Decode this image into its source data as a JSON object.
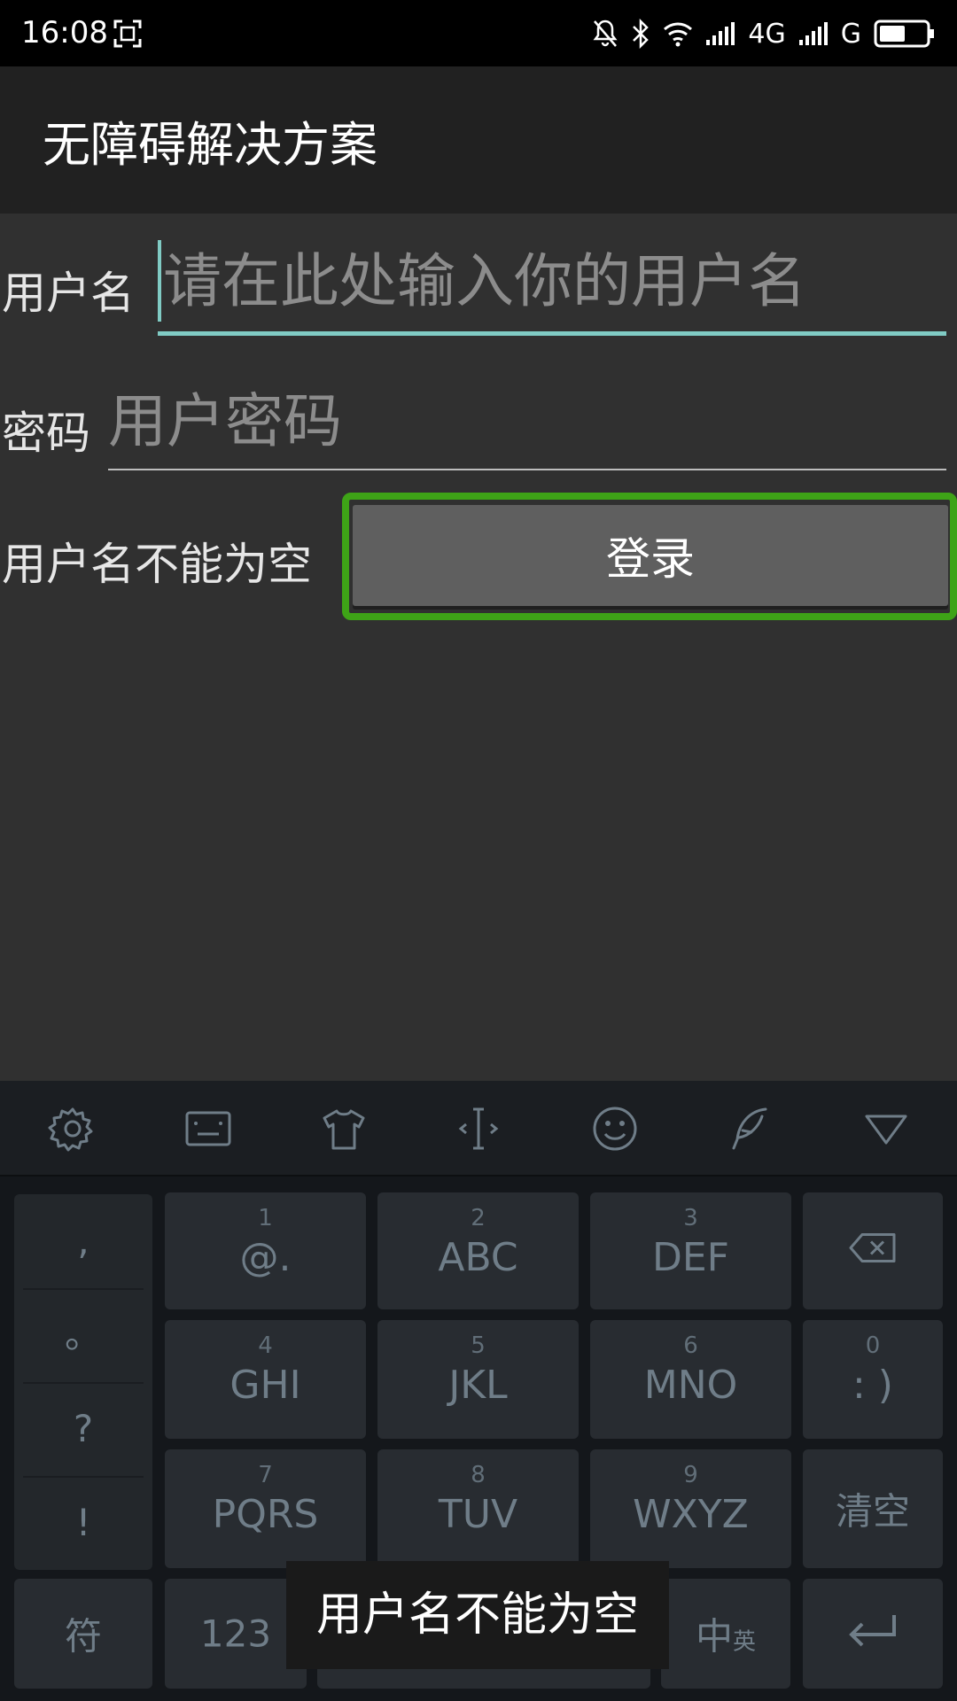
{
  "status_bar": {
    "time": "16:08",
    "network_1": "4G",
    "network_2": "G"
  },
  "app_bar": {
    "title": "无障碍解决方案"
  },
  "form": {
    "username_label": "用户名",
    "username_placeholder": "请在此处输入你的用户名",
    "password_label": "密码",
    "password_placeholder": "用户密码",
    "error_text": "用户名不能为空",
    "login_label": "登录"
  },
  "keyboard": {
    "toolbar_icons": [
      "gear-icon",
      "keyboard-icon",
      "tshirt-icon",
      "cursor-icon",
      "smiley-icon",
      "handwriting-icon",
      "collapse-icon"
    ],
    "punctuation": [
      ",",
      "。",
      "?",
      "!"
    ],
    "keys": [
      {
        "num": "1",
        "main": "@."
      },
      {
        "num": "2",
        "main": "ABC"
      },
      {
        "num": "3",
        "main": "DEF"
      },
      {
        "num": "4",
        "main": "GHI"
      },
      {
        "num": "5",
        "main": "JKL"
      },
      {
        "num": "6",
        "main": "MNO"
      },
      {
        "num": "0",
        "main": ": )"
      },
      {
        "num": "7",
        "main": "PQRS"
      },
      {
        "num": "8",
        "main": "TUV"
      },
      {
        "num": "9",
        "main": "WXYZ"
      }
    ],
    "clear_label": "清空",
    "symbol_label": "符",
    "num_label": "123",
    "lang_main": "中",
    "lang_sub": "英"
  },
  "toast": {
    "text": "用户名不能为空"
  },
  "colors": {
    "accent": "#80cbc4",
    "focus_outline": "#3ea317",
    "background": "#303030",
    "app_bar": "#212121"
  }
}
